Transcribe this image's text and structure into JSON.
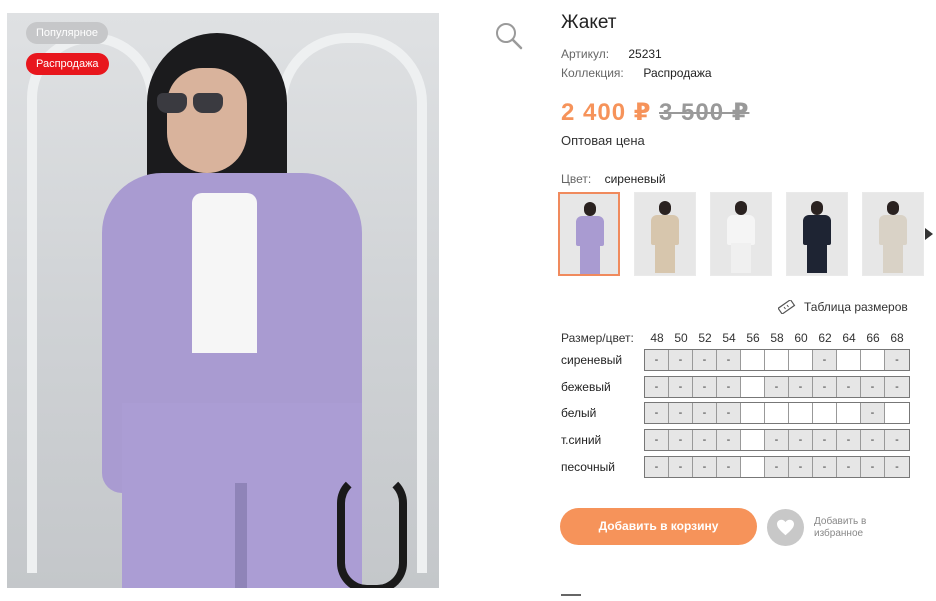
{
  "badges": {
    "popular": "Популярное",
    "sale": "Распродажа"
  },
  "product": {
    "title": "Жакет",
    "article_label": "Артикул:",
    "article_value": "25231",
    "collection_label": "Коллекция:",
    "collection_value": "Распродажа",
    "price": "2 400 ₽",
    "old_price": "3 500 ₽",
    "price_note": "Оптовая цена",
    "color_label": "Цвет:",
    "color_value": "сиреневый"
  },
  "thumbnails": [
    {
      "name": "thumb-lilac",
      "body": "#a99bd1",
      "legs": "#a99bd1",
      "active": true
    },
    {
      "name": "thumb-beige",
      "body": "#d7c6ad",
      "legs": "#d7c6ad",
      "active": false
    },
    {
      "name": "thumb-white",
      "body": "#f5f5f5",
      "legs": "#f0f0f0",
      "active": false
    },
    {
      "name": "thumb-navy",
      "body": "#1e2433",
      "legs": "#1e2433",
      "active": false
    },
    {
      "name": "thumb-sand",
      "body": "#d9d2c6",
      "legs": "#d9d2c6",
      "active": false
    }
  ],
  "size_table_link": "Таблица размеров",
  "sizes": {
    "header_label": "Размер/цвет:",
    "numbers": [
      "48",
      "50",
      "52",
      "54",
      "56",
      "58",
      "60",
      "62",
      "64",
      "66",
      "68"
    ],
    "rows": [
      {
        "color": "сиреневый",
        "cells": [
          "-",
          "-",
          "-",
          "-",
          "",
          "",
          "",
          "-",
          "",
          "",
          "-"
        ]
      },
      {
        "color": "бежевый",
        "cells": [
          "-",
          "-",
          "-",
          "-",
          "",
          "-",
          "-",
          "-",
          "-",
          "-",
          "-"
        ]
      },
      {
        "color": "белый",
        "cells": [
          "-",
          "-",
          "-",
          "-",
          "",
          "",
          "",
          "",
          "",
          "-",
          ""
        ]
      },
      {
        "color": "т.синий",
        "cells": [
          "-",
          "-",
          "-",
          "-",
          "",
          "-",
          "-",
          "-",
          "-",
          "-",
          "-"
        ]
      },
      {
        "color": "песочный",
        "cells": [
          "-",
          "-",
          "-",
          "-",
          "",
          "-",
          "-",
          "-",
          "-",
          "-",
          "-"
        ]
      }
    ]
  },
  "actions": {
    "add_to_cart": "Добавить в корзину",
    "favorite_line1": "Добавить в",
    "favorite_line2": "избранное"
  },
  "colors": {
    "accent": "#f6935a",
    "sale": "#e8161d",
    "badge_grey": "#c6c7c9"
  }
}
